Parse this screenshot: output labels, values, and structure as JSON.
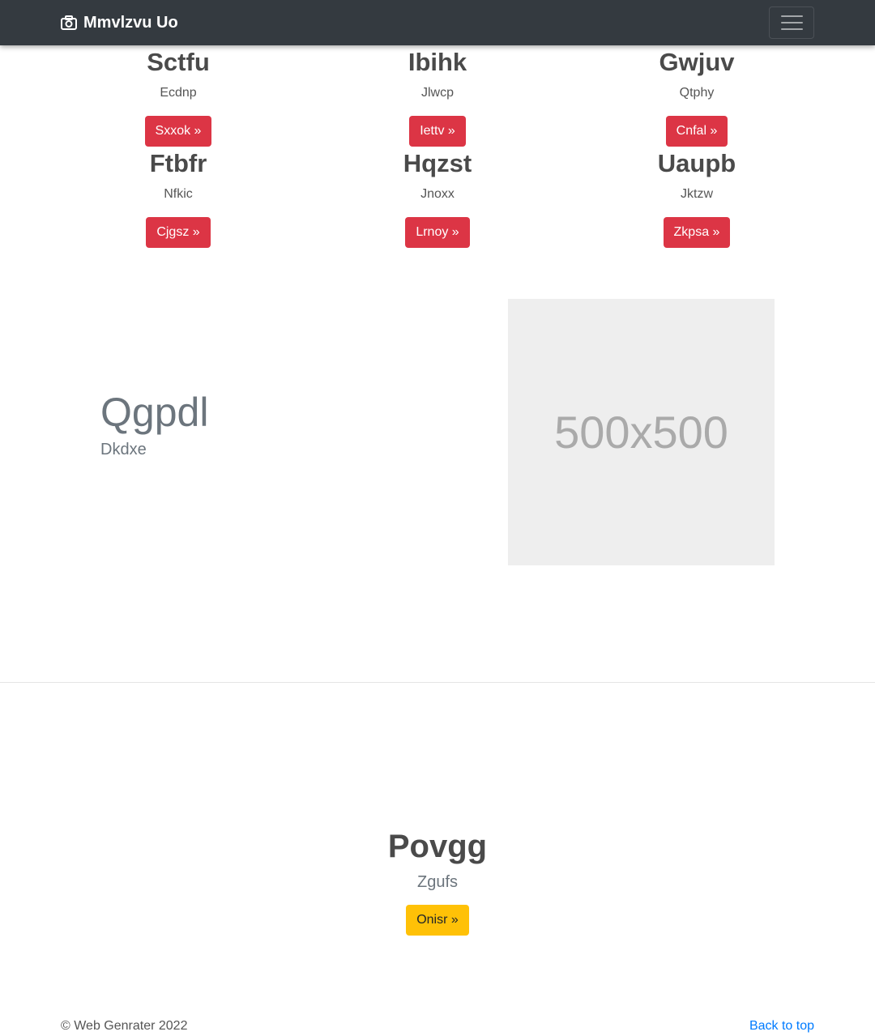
{
  "navbar": {
    "brand_icon": "camera-icon",
    "brand": "Mmvlzvu Uo",
    "toggler_icon": "hamburger-menu-icon"
  },
  "features": [
    {
      "title": "Sctfu",
      "text": "Ecdnp",
      "button": "Sxxok »"
    },
    {
      "title": "Ibihk",
      "text": "Jlwcp",
      "button": "Iettv »"
    },
    {
      "title": "Gwjuv",
      "text": "Qtphy",
      "button": "Cnfal »"
    },
    {
      "title": "Ftbfr",
      "text": "Nfkic",
      "button": "Cjgsz »"
    },
    {
      "title": "Hqzst",
      "text": "Jnoxx",
      "button": "Lrnoy »"
    },
    {
      "title": "Uaupb",
      "text": "Jktzw",
      "button": "Zkpsa »"
    }
  ],
  "hero": {
    "title": "Qgpdl",
    "subtitle": "Dkdxe",
    "image_label": "500x500"
  },
  "cta": {
    "title": "Povgg",
    "text": "Zgufs",
    "button": "Onisr »"
  },
  "footer": {
    "copyright": "© Web Genrater 2022",
    "back_to_top": "Back to top"
  },
  "colors": {
    "navbar": "#343a40",
    "button_danger": "#dc3545",
    "button_warning": "#ffc107",
    "link": "#007bff",
    "placeholder_bg": "#eeeeee"
  }
}
